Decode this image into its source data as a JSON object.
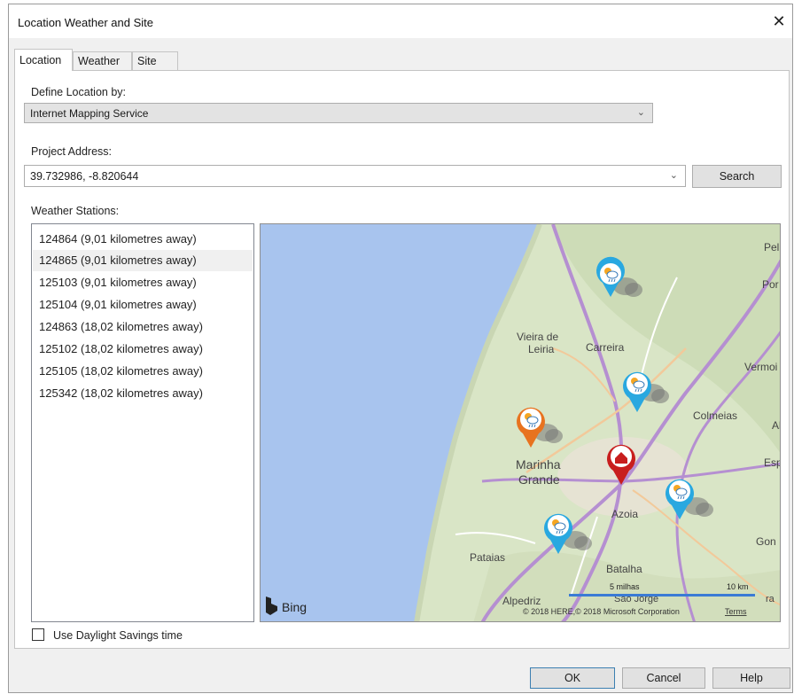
{
  "window": {
    "title": "Location Weather and Site",
    "close_glyph": "✕"
  },
  "tabs": [
    {
      "label": "Location"
    },
    {
      "label": "Weather"
    },
    {
      "label": "Site"
    }
  ],
  "define_location": {
    "label": "Define Location by:",
    "value": "Internet Mapping Service"
  },
  "project_address": {
    "label": "Project Address:",
    "value": "39.732986, -8.820644"
  },
  "search_button": "Search",
  "stations": {
    "label": "Weather Stations:",
    "items": [
      "124864 (9,01 kilometres away)",
      "124865 (9,01 kilometres away)",
      "125103 (9,01 kilometres away)",
      "125104 (9,01 kilometres away)",
      "124863 (18,02 kilometres away)",
      "125102 (18,02 kilometres away)",
      "125105 (18,02 kilometres away)",
      "125342 (18,02 kilometres away)"
    ],
    "selected_index": 1
  },
  "map": {
    "places": {
      "vieira": "Vieira de",
      "leiria": "Leiria",
      "carreira": "Carreira",
      "marinha": "Marinha",
      "grande": "Grande",
      "azoia": "Azoia",
      "pataias": "Pataias",
      "batalha": "Batalha",
      "alpedriz": "Alpedriz",
      "sao_jorge": "São Jorge",
      "colmeias": "Colmeias",
      "vermoil": "Vermoi",
      "pel": "Pel",
      "por": "Por",
      "esp": "Esp",
      "gon": "Gon",
      "al": "Al",
      "ra": "ra"
    },
    "bing": "Bing",
    "scale_miles": "5 milhas",
    "scale_km": "10 km",
    "copyright": "© 2018 HERE,© 2018 Microsoft Corporation",
    "terms": "Terms",
    "colors": {
      "water": "#a8c4ee",
      "land": "#d8e4c4",
      "station_pin": "#29a8e0",
      "selected_pin": "#e8731f",
      "home_pin": "#c81e1e"
    }
  },
  "daylight_savings": {
    "label": "Use Daylight Savings time",
    "checked": false
  },
  "buttons": {
    "ok": "OK",
    "cancel": "Cancel",
    "help": "Help"
  }
}
